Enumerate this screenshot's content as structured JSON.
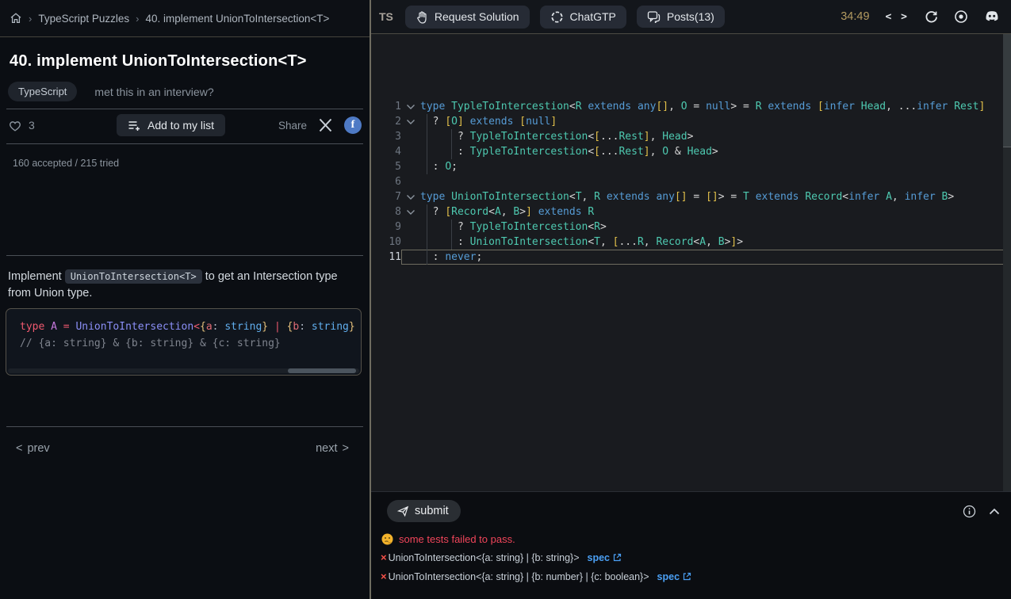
{
  "breadcrumb": {
    "items": [
      "TypeScript Puzzles",
      "40. implement UnionToIntersection<T>"
    ],
    "separator": "›"
  },
  "toolbar": {
    "ts_label": "TS",
    "request_solution_label": "Request Solution",
    "chatgtp_label": "ChatGTP",
    "posts_label": "Posts(13)",
    "timer": "34:49",
    "code_glyph": "< >"
  },
  "puzzle": {
    "title": "40. implement UnionToIntersection<T>",
    "badge": "TypeScript",
    "interview_link": "met this in an interview?",
    "likes": "3",
    "add_to_list_label": "Add to my list",
    "share_label": "Share",
    "facebook_glyph": "f",
    "stats": "160 accepted / 215 tried",
    "desc_before": "Implement ",
    "desc_code": "UnionToIntersection<T>",
    "desc_after": " to get an Intersection type from Union type.",
    "prev_arrow": "<",
    "prev_label": "prev",
    "next_label": "next",
    "next_arrow": ">"
  },
  "example": {
    "lines": [
      [
        [
          "r",
          "type"
        ],
        [
          "w",
          " "
        ],
        [
          "v",
          "A"
        ],
        [
          "w",
          " "
        ],
        [
          "r",
          "="
        ],
        [
          "w",
          " "
        ],
        [
          "n",
          "UnionToIntersection"
        ],
        [
          "r",
          "<"
        ],
        [
          "c",
          "{"
        ],
        [
          "a",
          "a"
        ],
        [
          "w",
          ": "
        ],
        [
          "s",
          "string"
        ],
        [
          "c",
          "}"
        ],
        [
          "w",
          " "
        ],
        [
          "r",
          "|"
        ],
        [
          "w",
          " "
        ],
        [
          "c",
          "{"
        ],
        [
          "a",
          "b"
        ],
        [
          "w",
          ": "
        ],
        [
          "s",
          "string"
        ],
        [
          "c",
          "}"
        ],
        [
          "w",
          " "
        ],
        [
          "r",
          "|"
        ]
      ],
      [
        [
          "m",
          "// {a: string} & {b: string} & {c: string}"
        ]
      ]
    ]
  },
  "editor": {
    "lines": [
      {
        "num": "1",
        "fold": true,
        "guides": [],
        "tokens": [
          [
            "k",
            "type"
          ],
          [
            "p",
            " "
          ],
          [
            "t",
            "TypleToIntercestion"
          ],
          [
            "p",
            "<"
          ],
          [
            "t",
            "R"
          ],
          [
            "p",
            " "
          ],
          [
            "k",
            "extends"
          ],
          [
            "p",
            " "
          ],
          [
            "k",
            "any"
          ],
          [
            "b",
            "[]"
          ],
          [
            "p",
            ", "
          ],
          [
            "t",
            "O"
          ],
          [
            "p",
            " = "
          ],
          [
            "k",
            "null"
          ],
          [
            "p",
            "> = "
          ],
          [
            "t",
            "R"
          ],
          [
            "p",
            " "
          ],
          [
            "k",
            "extends"
          ],
          [
            "p",
            " "
          ],
          [
            "b",
            "["
          ],
          [
            "k",
            "infer"
          ],
          [
            "p",
            " "
          ],
          [
            "t",
            "Head"
          ],
          [
            "p",
            ", ..."
          ],
          [
            "k",
            "infer"
          ],
          [
            "p",
            " "
          ],
          [
            "t",
            "Rest"
          ],
          [
            "b",
            "]"
          ]
        ]
      },
      {
        "num": "2",
        "fold": true,
        "guides": [
          1
        ],
        "tokens": [
          [
            "p",
            "  ? "
          ],
          [
            "b",
            "["
          ],
          [
            "t",
            "O"
          ],
          [
            "b",
            "]"
          ],
          [
            "p",
            " "
          ],
          [
            "k",
            "extends"
          ],
          [
            "p",
            " "
          ],
          [
            "b",
            "["
          ],
          [
            "k",
            "null"
          ],
          [
            "b",
            "]"
          ]
        ]
      },
      {
        "num": "3",
        "fold": false,
        "guides": [
          1,
          5
        ],
        "tokens": [
          [
            "p",
            "      ? "
          ],
          [
            "t",
            "TypleToIntercestion"
          ],
          [
            "p",
            "<"
          ],
          [
            "b",
            "["
          ],
          [
            "p",
            "..."
          ],
          [
            "t",
            "Rest"
          ],
          [
            "b",
            "]"
          ],
          [
            "p",
            ", "
          ],
          [
            "t",
            "Head"
          ],
          [
            "p",
            ">"
          ]
        ]
      },
      {
        "num": "4",
        "fold": false,
        "guides": [
          1,
          5
        ],
        "tokens": [
          [
            "p",
            "      : "
          ],
          [
            "t",
            "TypleToIntercestion"
          ],
          [
            "p",
            "<"
          ],
          [
            "b",
            "["
          ],
          [
            "p",
            "..."
          ],
          [
            "t",
            "Rest"
          ],
          [
            "b",
            "]"
          ],
          [
            "p",
            ", "
          ],
          [
            "t",
            "O"
          ],
          [
            "p",
            " & "
          ],
          [
            "t",
            "Head"
          ],
          [
            "p",
            ">"
          ]
        ]
      },
      {
        "num": "5",
        "fold": false,
        "guides": [
          1
        ],
        "tokens": [
          [
            "p",
            "  : "
          ],
          [
            "t",
            "O"
          ],
          [
            "p",
            ";"
          ]
        ]
      },
      {
        "num": "6",
        "fold": false,
        "guides": [],
        "tokens": []
      },
      {
        "num": "7",
        "fold": true,
        "guides": [],
        "tokens": [
          [
            "k",
            "type"
          ],
          [
            "p",
            " "
          ],
          [
            "t",
            "UnionToIntersection"
          ],
          [
            "p",
            "<"
          ],
          [
            "t",
            "T"
          ],
          [
            "p",
            ", "
          ],
          [
            "t",
            "R"
          ],
          [
            "p",
            " "
          ],
          [
            "k",
            "extends"
          ],
          [
            "p",
            " "
          ],
          [
            "k",
            "any"
          ],
          [
            "b",
            "[]"
          ],
          [
            "p",
            " = "
          ],
          [
            "b",
            "[]"
          ],
          [
            "p",
            "> = "
          ],
          [
            "t",
            "T"
          ],
          [
            "p",
            " "
          ],
          [
            "k",
            "extends"
          ],
          [
            "p",
            " "
          ],
          [
            "t",
            "Record"
          ],
          [
            "p",
            "<"
          ],
          [
            "k",
            "infer"
          ],
          [
            "p",
            " "
          ],
          [
            "t",
            "A"
          ],
          [
            "p",
            ", "
          ],
          [
            "k",
            "infer"
          ],
          [
            "p",
            " "
          ],
          [
            "t",
            "B"
          ],
          [
            "p",
            ">"
          ]
        ]
      },
      {
        "num": "8",
        "fold": true,
        "guides": [
          1
        ],
        "tokens": [
          [
            "p",
            "  ? "
          ],
          [
            "b",
            "["
          ],
          [
            "t",
            "Record"
          ],
          [
            "p",
            "<"
          ],
          [
            "t",
            "A"
          ],
          [
            "p",
            ", "
          ],
          [
            "t",
            "B"
          ],
          [
            "p",
            ">"
          ],
          [
            "b",
            "]"
          ],
          [
            "p",
            " "
          ],
          [
            "k",
            "extends"
          ],
          [
            "p",
            " "
          ],
          [
            "t",
            "R"
          ]
        ]
      },
      {
        "num": "9",
        "fold": false,
        "guides": [
          1,
          5
        ],
        "tokens": [
          [
            "p",
            "      ? "
          ],
          [
            "t",
            "TypleToIntercestion"
          ],
          [
            "p",
            "<"
          ],
          [
            "t",
            "R"
          ],
          [
            "p",
            ">"
          ]
        ]
      },
      {
        "num": "10",
        "fold": false,
        "guides": [
          1,
          5
        ],
        "tokens": [
          [
            "p",
            "      : "
          ],
          [
            "t",
            "UnionToIntersection"
          ],
          [
            "p",
            "<"
          ],
          [
            "t",
            "T"
          ],
          [
            "p",
            ", "
          ],
          [
            "b",
            "["
          ],
          [
            "p",
            "..."
          ],
          [
            "t",
            "R"
          ],
          [
            "p",
            ", "
          ],
          [
            "t",
            "Record"
          ],
          [
            "p",
            "<"
          ],
          [
            "t",
            "A"
          ],
          [
            "p",
            ", "
          ],
          [
            "t",
            "B"
          ],
          [
            "p",
            ">"
          ],
          [
            "b",
            "]"
          ],
          [
            "p",
            ">"
          ]
        ]
      },
      {
        "num": "11",
        "fold": false,
        "current": true,
        "guides": [
          1
        ],
        "tokens": [
          [
            "p",
            "  : "
          ],
          [
            "k",
            "never"
          ],
          [
            "p",
            ";"
          ]
        ]
      }
    ]
  },
  "results": {
    "submit_label": "submit",
    "status_text": "some tests failed to pass.",
    "fail_mark": "×",
    "tests": [
      {
        "label": "UnionToIntersection<{a: string} | {b: string}>",
        "link": "spec"
      },
      {
        "label": "UnionToIntersection<{a: string} | {b: number} | {c: boolean}>",
        "link": "spec"
      }
    ]
  },
  "colors": {
    "panel_divider": "#6e6c60",
    "timer": "#b49b61",
    "error": "#f0455a",
    "link": "#4ba0f5",
    "facebook": "#4e7ac5",
    "kw_blue": "#569cd6",
    "type_teal": "#4ec9b0",
    "bracket_gold": "#e2c04a"
  }
}
